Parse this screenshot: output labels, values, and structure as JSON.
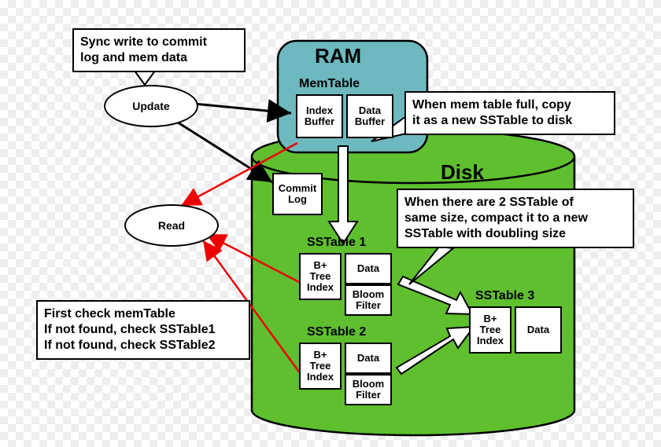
{
  "regions": {
    "ram": "RAM",
    "disk": "Disk"
  },
  "nodes": {
    "update": "Update",
    "read": "Read"
  },
  "memtable": {
    "title": "MemTable",
    "index_buffer": "Index\nBuffer",
    "data_buffer": "Data\nBuffer"
  },
  "commit_log": "Commit\nLog",
  "sstable1": {
    "title": "SSTable 1",
    "bptree": "B+\nTree\nIndex",
    "data": "Data",
    "bloom": "Bloom\nFilter"
  },
  "sstable2": {
    "title": "SSTable 2",
    "bptree": "B+\nTree\nIndex",
    "data": "Data",
    "bloom": "Bloom\nFilter"
  },
  "sstable3": {
    "title": "SSTable 3",
    "bptree": "B+\nTree\nIndex",
    "data": "Data"
  },
  "callouts": {
    "sync": "Sync write to commit\nlog and mem data",
    "flush": "When mem table full, copy\nit as a new SSTable to disk",
    "compact": "When there are 2 SSTable of\nsame size, compact it to a new\nSSTable with doubling size",
    "read_path": "First check memTable\nIf not found, check SSTable1\nIf not found, check SSTable2"
  }
}
